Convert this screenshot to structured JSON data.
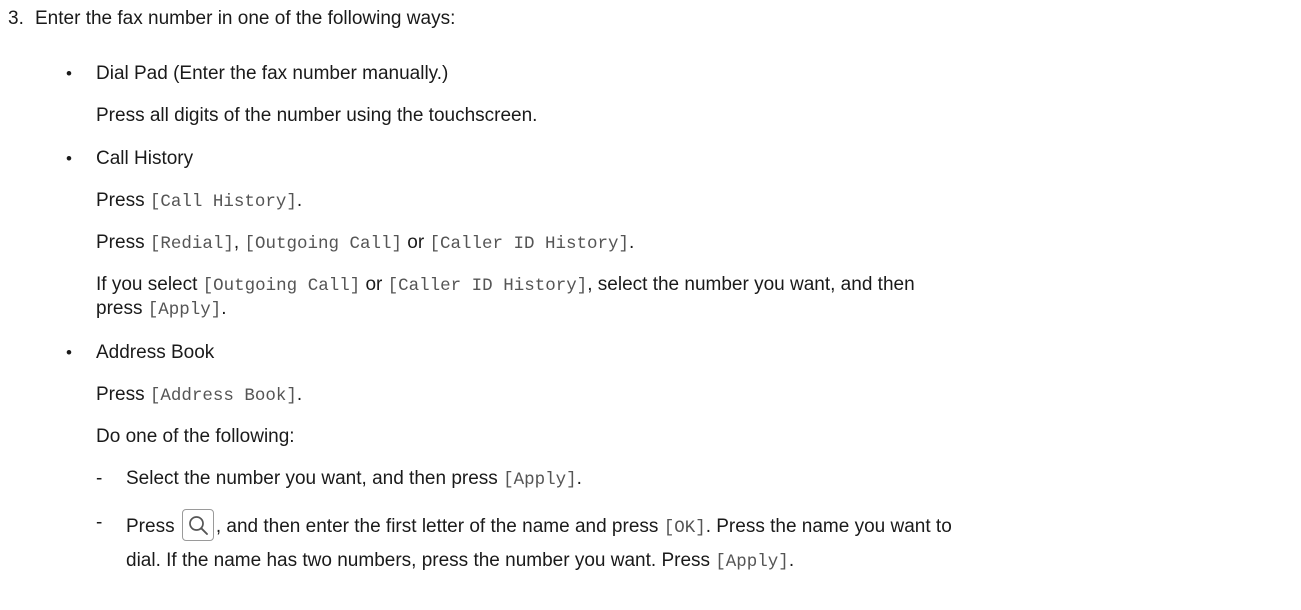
{
  "step": {
    "number": "3.",
    "text": "Enter the fax number in one of the following ways:"
  },
  "methods": [
    {
      "title": "Dial Pad (Enter the fax number manually.)",
      "desc": "Press all digits of the number using the touchscreen."
    },
    {
      "title": "Call History",
      "press": "Press",
      "call_history_label": "[Call History]",
      "period": ".",
      "redial_label": "[Redial]",
      "comma": ",",
      "outgoing_label": "[Outgoing Call]",
      "or": "or",
      "caller_id_label": "[Caller ID History]",
      "if_you_select": "If you select",
      "select_number_then": ", select the number you want, and then",
      "press_lower": "press",
      "apply_label": "[Apply]"
    },
    {
      "title": "Address Book",
      "press": "Press",
      "address_book_label": "[Address Book]",
      "period": ".",
      "do_one": "Do one of the following:",
      "options": [
        {
          "text": "Select the number you want, and then press",
          "apply_label": "[Apply]"
        },
        {
          "press": "Press",
          "text_after_icon": ", and then enter the first letter of the name and press",
          "ok_label": "[OK]",
          "text_after_ok": ". Press the name you want to",
          "line2": "dial. If the name has two numbers, press the number you want. Press",
          "apply_label": "[Apply]"
        }
      ]
    }
  ],
  "icons": {
    "search": "search-icon"
  }
}
